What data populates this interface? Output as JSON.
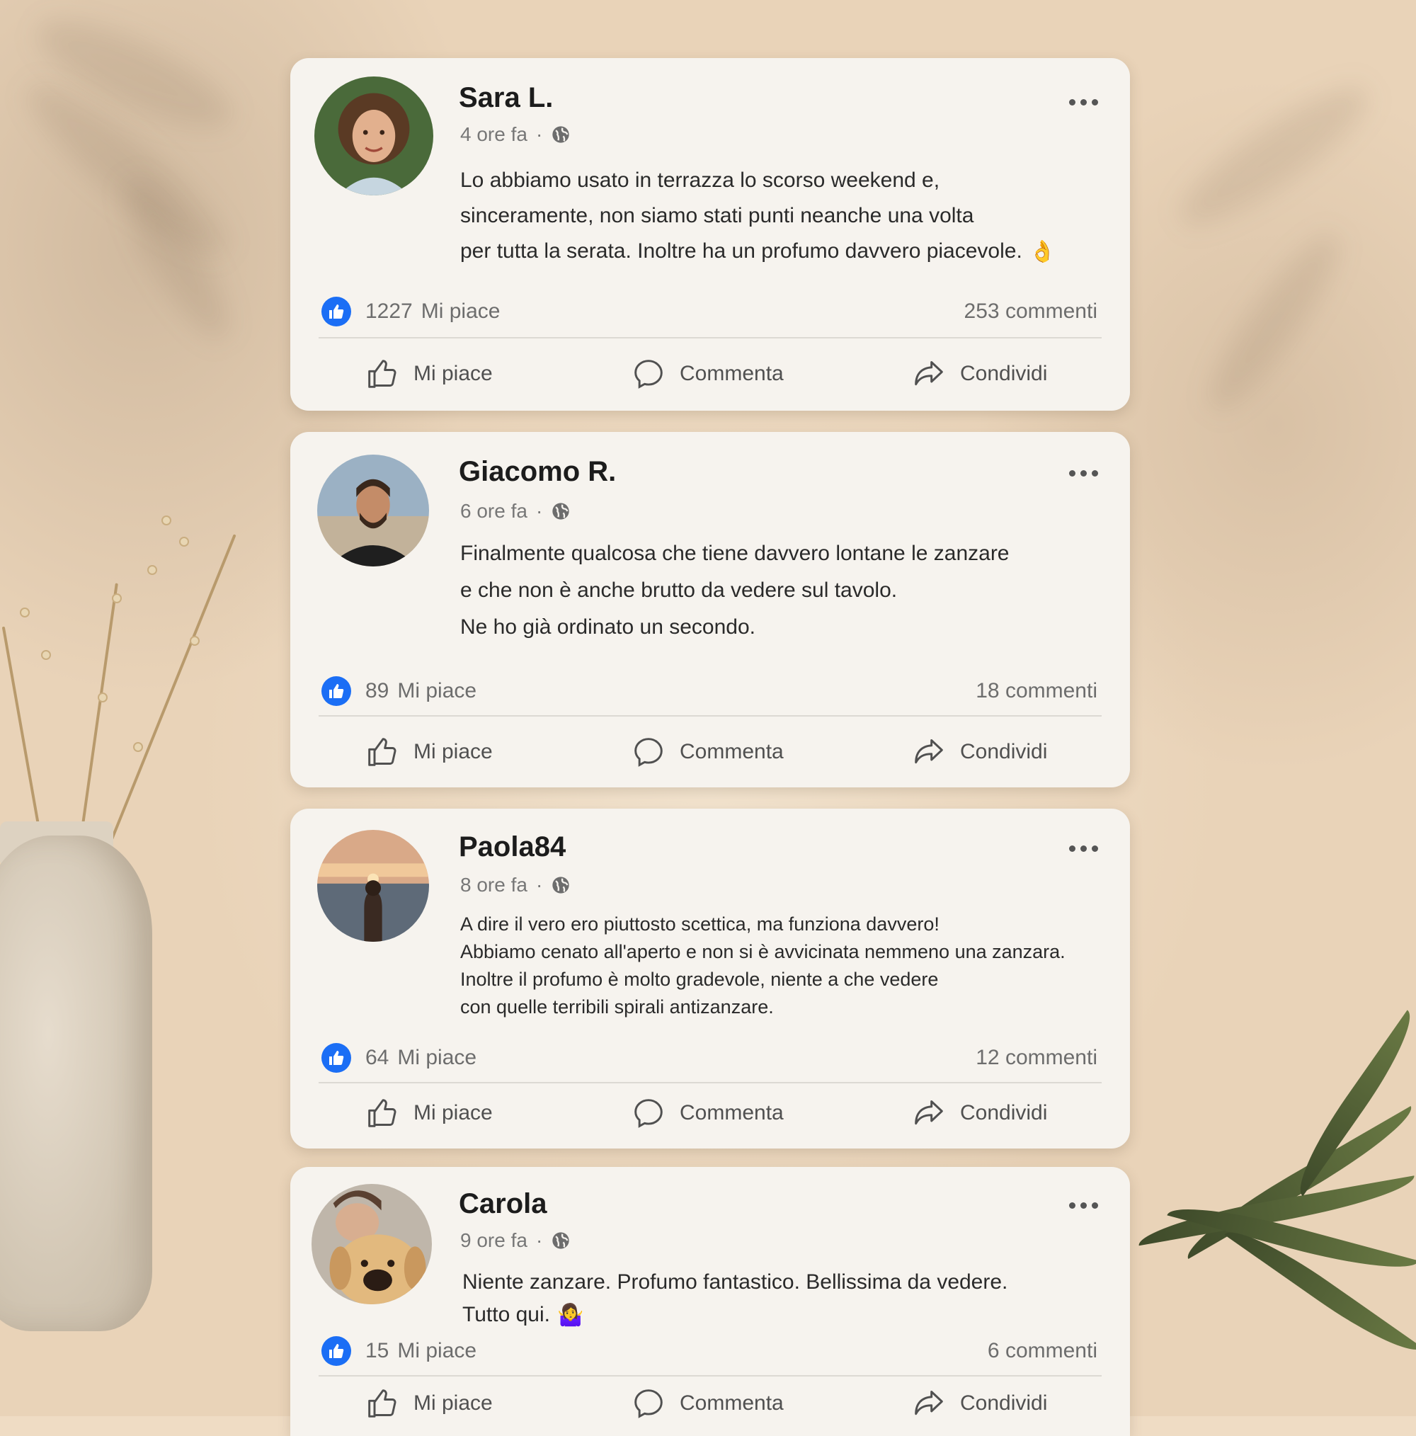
{
  "posts": [
    {
      "name": "Sara L.",
      "time": "4 ore fa",
      "lines": [
        "Lo abbiamo usato in terrazza lo scorso weekend e,",
        "sinceramente, non siamo stati punti neanche una volta",
        "per tutta la serata. Inoltre ha un profumo davvero piacevole."
      ],
      "emoji": "👌",
      "likes": "1227",
      "likes_label": "Mi piace",
      "comments": "253",
      "comments_label": "commenti"
    },
    {
      "name": "Giacomo R.",
      "time": "6 ore fa",
      "lines": [
        "Finalmente qualcosa che tiene davvero lontane le zanzare",
        "e che non è anche brutto da vedere sul tavolo.",
        "Ne ho già ordinato un secondo."
      ],
      "emoji": "",
      "likes": "89",
      "likes_label": "Mi piace",
      "comments": "18",
      "comments_label": "commenti"
    },
    {
      "name": "Paola84",
      "time": "8 ore fa",
      "lines": [
        "A dire il vero ero piuttosto scettica, ma funziona davvero!",
        "Abbiamo cenato all'aperto e non si è avvicinata nemmeno una zanzara.",
        "Inoltre il profumo è molto gradevole, niente a che vedere",
        "con quelle terribili spirali antizanzare."
      ],
      "emoji": "",
      "likes": "64",
      "likes_label": "Mi piace",
      "comments": "12",
      "comments_label": "commenti"
    },
    {
      "name": "Carola",
      "time": "9 ore fa",
      "lines": [
        "Niente zanzare. Profumo fantastico. Bellissima da vedere.",
        "Tutto qui."
      ],
      "emoji": "🤷‍♀️",
      "likes": "15",
      "likes_label": "Mi piace",
      "comments": "6",
      "comments_label": "commenti"
    }
  ],
  "actions": {
    "like": "Mi piace",
    "comment": "Commenta",
    "share": "Condividi"
  },
  "colors": {
    "like_blue": "#1b6ef5",
    "card_bg": "#f6f3ee"
  }
}
